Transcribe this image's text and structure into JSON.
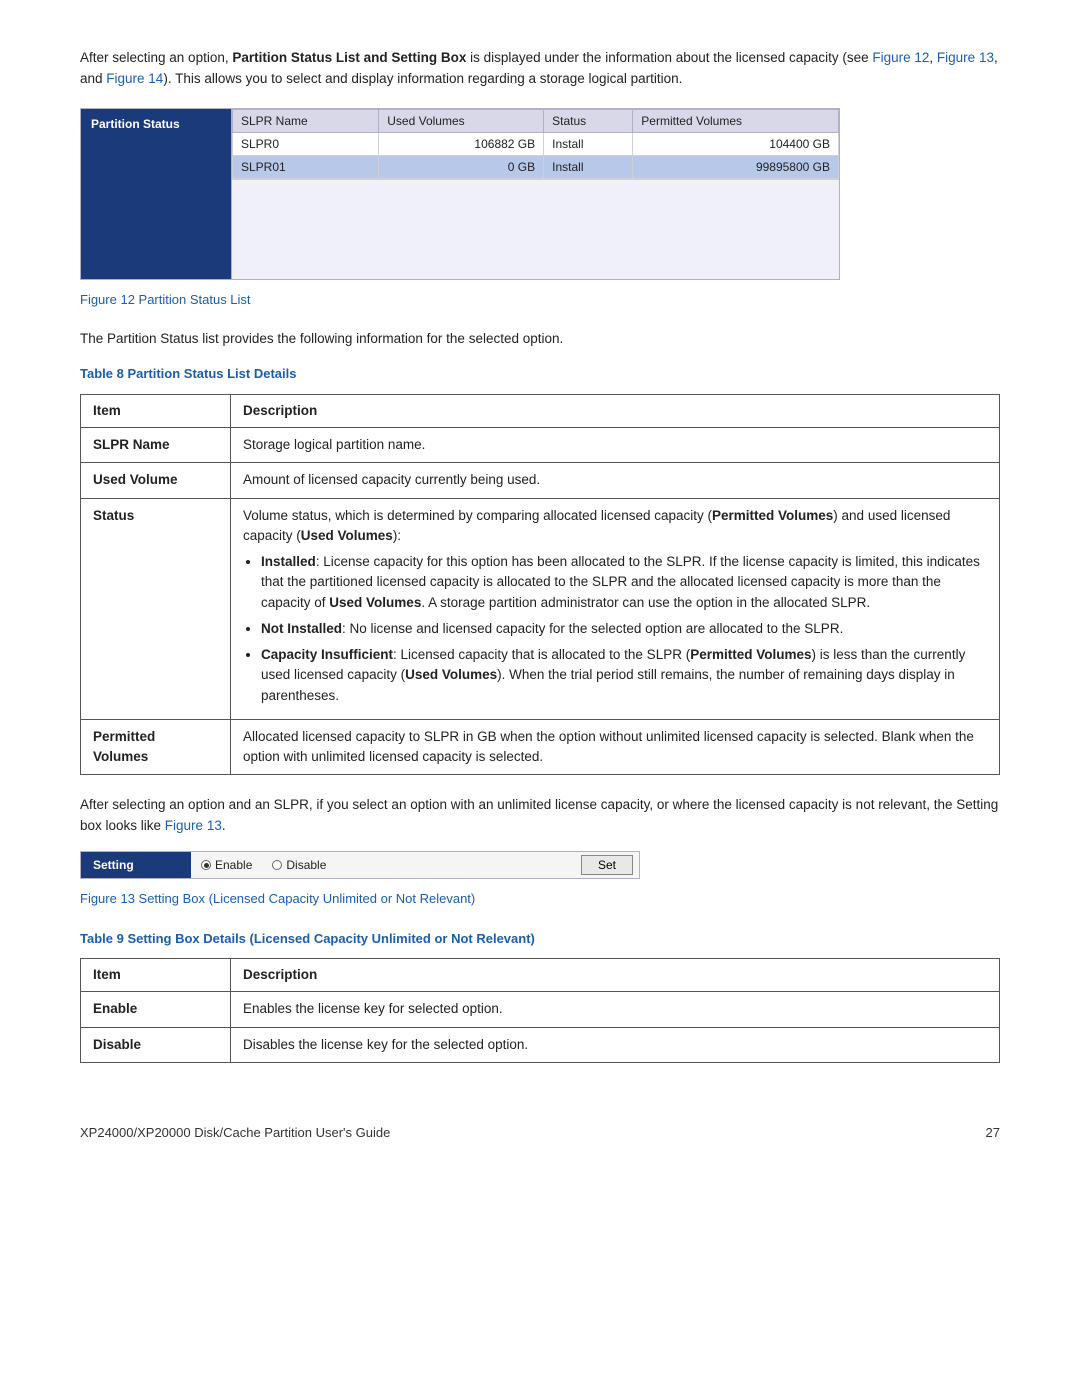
{
  "intro": {
    "text1": "After selecting an option, ",
    "bold1": "Partition Status List and Setting Box",
    "text2": " is displayed under the information about the licensed capacity (see ",
    "link1": "Figure 12",
    "text3": ", ",
    "link2": "Figure 13",
    "text4": ", and ",
    "link3": "Figure 14",
    "text5": "). This allows you to select and display information regarding a storage logical partition."
  },
  "partition_ui": {
    "left_label": "Partition Status",
    "columns": [
      "SLPR Name",
      "Used Volumes",
      "Status",
      "Permitted Volumes"
    ],
    "rows": [
      {
        "slpr_name": "SLPR0",
        "used_volumes": "106882 GB",
        "status": "Install",
        "permitted_volumes": "104400 GB",
        "selected": false
      },
      {
        "slpr_name": "SLPR01",
        "used_volumes": "0 GB",
        "status": "Install",
        "permitted_volumes": "99895800 GB",
        "selected": true
      }
    ]
  },
  "figure12_caption": "Figure 12 Partition Status List",
  "body_para1": "The Partition Status list provides the following information for the selected option.",
  "table8_heading": "Table 8 Partition Status List Details",
  "table8": {
    "col_item": "Item",
    "col_description": "Description",
    "rows": [
      {
        "item": "SLPR Name",
        "description": "Storage logical partition name."
      },
      {
        "item": "Used Volume",
        "description": "Amount of licensed capacity currently being used."
      },
      {
        "item": "Status",
        "description_intro": "Volume status, which is determined by comparing allocated licensed capacity (",
        "description_bold1": "Permitted Volumes",
        "description_mid": ") and used licensed capacity (",
        "description_bold2": "Used Volumes",
        "description_end": "):",
        "bullets": [
          {
            "bold": "Installed",
            "text": ": License capacity for this option has been allocated to the SLPR. If the license capacity is limited, this indicates that the partitioned licensed capacity is allocated to the SLPR and the allocated licensed capacity is more than the capacity of ",
            "bold2": "Used Volumes",
            "text2": ". A storage partition administrator can use the option in the allocated SLPR."
          },
          {
            "bold": "Not Installed",
            "text": ": No license and licensed capacity for the selected option are allocated to the SLPR."
          },
          {
            "bold": "Capacity Insufficient",
            "text": ": Licensed capacity that is allocated to the SLPR (",
            "bold2": "Permitted Volumes",
            "text2": ") is less than the currently used licensed capacity (",
            "bold3": "Used Volumes",
            "text3": "). When the trial period still remains, the number of remaining days display in parentheses."
          }
        ]
      },
      {
        "item_line1": "Permitted",
        "item_line2": "Volumes",
        "description": "Allocated licensed capacity to SLPR in GB when the option without unlimited licensed capacity is selected. Blank when the option with unlimited licensed capacity is selected."
      }
    ]
  },
  "body_para2_text1": "After selecting an option and an SLPR, if you select an option with an unlimited license capacity, or where the licensed capacity is not relevant, the Setting box looks like ",
  "body_para2_link": "Figure 13",
  "body_para2_text2": ".",
  "setting_ui": {
    "label": "Setting",
    "option_enable": "Enable",
    "option_disable": "Disable",
    "btn_set": "Set"
  },
  "figure13_caption": "Figure 13 Setting Box (Licensed Capacity Unlimited or Not Relevant)",
  "table9_heading": "Table 9 Setting Box Details (Licensed Capacity Unlimited or Not Relevant)",
  "table9": {
    "col_item": "Item",
    "col_description": "Description",
    "rows": [
      {
        "item": "Enable",
        "description": "Enables the license key for selected option."
      },
      {
        "item": "Disable",
        "description": "Disables the license key for the selected option."
      }
    ]
  },
  "footer": {
    "title": "XP24000/XP20000 Disk/Cache Partition User's Guide",
    "page": "27"
  }
}
